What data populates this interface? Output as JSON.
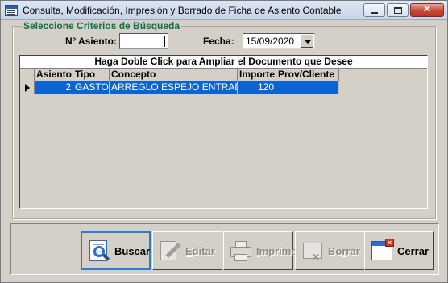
{
  "window": {
    "title": "Consulta, Modificación, Impresión y Borrado de Ficha de Asiento Contable"
  },
  "search": {
    "legend": "Seleccione Criterios de Búsqueda",
    "asiento_label": "Nº Asiento:",
    "asiento_value": "",
    "fecha_label": "Fecha:",
    "fecha_value": "15/09/2020"
  },
  "grid": {
    "caption": "Haga Doble Click para Ampliar el Documento que Desee",
    "columns": [
      "Asiento",
      "Tipo",
      "Concepto",
      "Importe",
      "Prov/Cliente"
    ],
    "rows": [
      {
        "asiento": "2",
        "tipo": "GASTO",
        "concepto": "ARREGLO ESPEJO ENTRADA",
        "importe": "120",
        "prov_cliente": ""
      }
    ]
  },
  "buttons": {
    "buscar": {
      "mnemonic": "B",
      "rest": "uscar",
      "enabled": true
    },
    "editar": {
      "mnemonic": "E",
      "rest": "ditar",
      "enabled": false
    },
    "imprime": {
      "mnemonic": "I",
      "rest": "mprime",
      "enabled": false
    },
    "borrar": {
      "pre": "Bo",
      "mnemonic": "r",
      "rest": "rar",
      "enabled": false
    },
    "cerrar": {
      "mnemonic": "C",
      "rest": "errar",
      "enabled": true
    }
  },
  "icons": {
    "app": "form-icon",
    "buscar": "search-document-icon",
    "editar": "edit-pencil-icon",
    "imprime": "printer-icon",
    "borrar": "delete-document-icon",
    "cerrar": "close-window-icon"
  },
  "colors": {
    "selection": "#0a64d2",
    "legend": "#0e6d4c",
    "focus_border": "#2a7bd3"
  }
}
